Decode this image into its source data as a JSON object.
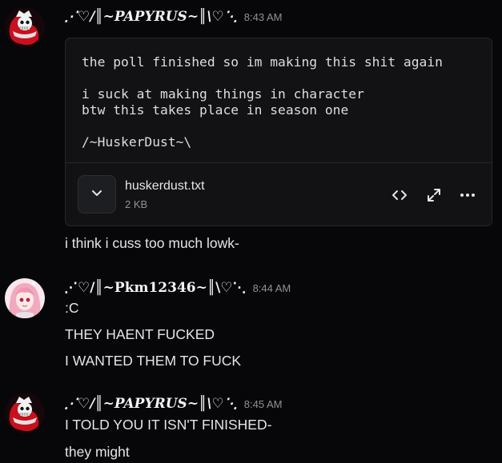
{
  "messages": [
    {
      "username": "⋰♡/║~PAPYRUS~║\\♡⋱",
      "timestamp": "8:43 AM",
      "code_lines": [
        "the poll finished so im making this shit again",
        "",
        "i suck at making things in character",
        "btw this takes place in season one",
        "",
        "/~HuskerDust~\\"
      ],
      "attachment": {
        "filename": "huskerdust.txt",
        "size": "2 KB"
      },
      "lines": [
        "i think i cuss too much lowk-"
      ]
    },
    {
      "username": "⋰♡/║~Pkm12346~║\\♡⋱",
      "timestamp": "8:44 AM",
      "lines": [
        ":C",
        "THEY HAENT FUCKED",
        "I WANTED THEM TO FUCK"
      ]
    },
    {
      "username": "⋰♡/║~PAPYRUS~║\\♡⋱",
      "timestamp": "8:45 AM",
      "lines": [
        "I TOLD YOU IT ISN'T FINISHED-",
        "they might"
      ]
    }
  ],
  "icons": {
    "expand": "chevron-down-icon",
    "code": "code-brackets-icon",
    "fullscreen": "maximize-icon",
    "more": "more-dots-icon"
  },
  "colors": {
    "background": "#070709",
    "avatar_red": "#c8101e",
    "avatar_pink": "#f4c6d4"
  }
}
